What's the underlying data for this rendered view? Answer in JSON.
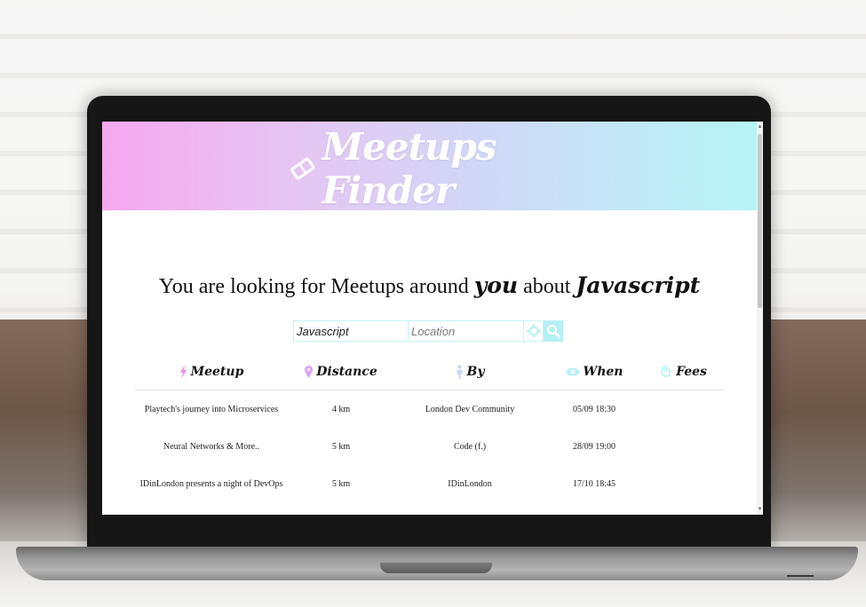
{
  "app": {
    "title": "Meetups Finder",
    "brand_gradient": [
      "#f7a8ef",
      "#b5f5f6"
    ]
  },
  "headline": {
    "prefix": "You are looking for Meetups around",
    "you": "you",
    "about": "about",
    "topic": "Javascript"
  },
  "search": {
    "topic_value": "Javascript",
    "location_placeholder": "Location",
    "locate_icon": "crosshair-icon",
    "search_icon": "search-icon"
  },
  "table": {
    "headers": [
      {
        "label": "Meetup",
        "icon": "lightning-icon",
        "color": "#f28be6"
      },
      {
        "label": "Distance",
        "icon": "pin-icon",
        "color": "#d9a6f0"
      },
      {
        "label": "By",
        "icon": "person-icon",
        "color": "#c9d7f4"
      },
      {
        "label": "When",
        "icon": "eye-icon",
        "color": "#b8eef3"
      },
      {
        "label": "Fees",
        "icon": "hand-icon",
        "color": "#b5f5f6"
      }
    ],
    "rows": [
      {
        "meetup": "Playtech's journey into Microservices",
        "distance": "4 km",
        "by": "London Dev Community",
        "when": "05/09 18:30",
        "fees": ""
      },
      {
        "meetup": "Neural Networks & More..",
        "distance": "5 km",
        "by": "Code (f.)",
        "when": "28/09 19:00",
        "fees": ""
      },
      {
        "meetup": "IDinLondon presents a night of DevOps",
        "distance": "5 km",
        "by": "IDinLondon",
        "when": "17/10 18:45",
        "fees": ""
      }
    ]
  }
}
